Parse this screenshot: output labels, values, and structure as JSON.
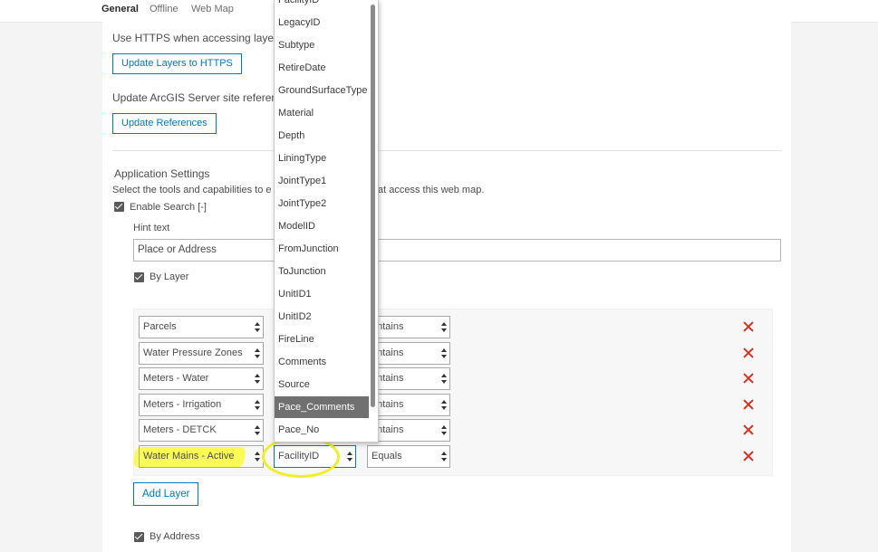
{
  "tabs": [
    "General",
    "Offline",
    "Web Map"
  ],
  "https_section": {
    "text": "Use HTTPS when accessing layers.",
    "button": "Update Layers to HTTPS"
  },
  "references_section": {
    "text": "Update ArcGIS Server site referenc",
    "button": "Update References"
  },
  "app_settings": {
    "heading": "Application Settings",
    "desc_left": "Select the tools and capabilities to e",
    "desc_right": "at access this web map.",
    "enable_search": "Enable Search [-]",
    "hint_label": "Hint text",
    "hint_value": "Place or Address",
    "by_layer": "By Layer",
    "add_layer": "Add Layer",
    "by_address": "By Address"
  },
  "layer_rows": [
    {
      "layer": "Parcels",
      "operator": "ontains"
    },
    {
      "layer": "Water Pressure Zones",
      "operator": "ontains"
    },
    {
      "layer": "Meters - Water",
      "operator": "ontains"
    },
    {
      "layer": "Meters - Irrigation",
      "operator": "ontains"
    },
    {
      "layer": "Meters - DETCK",
      "operator": "ontains"
    },
    {
      "layer": "Water Mains - Active",
      "field": "FacilityID",
      "operator": "Equals"
    }
  ],
  "field_options": [
    "FacilityID",
    "LegacyID",
    "Subtype",
    "RetireDate",
    "GroundSurfaceType",
    "Material",
    "Depth",
    "LiningType",
    "JointType1",
    "JointType2",
    "ModelID",
    "FromJunction",
    "ToJunction",
    "UnitID1",
    "UnitID2",
    "FireLine",
    "Comments",
    "Source",
    "Pace_Comments",
    "Pace_No"
  ],
  "highlighted_option": "Pace_Comments",
  "colors": {
    "accent": "#0079c1",
    "remove": "#d83020",
    "annotation": "#f0f020"
  }
}
